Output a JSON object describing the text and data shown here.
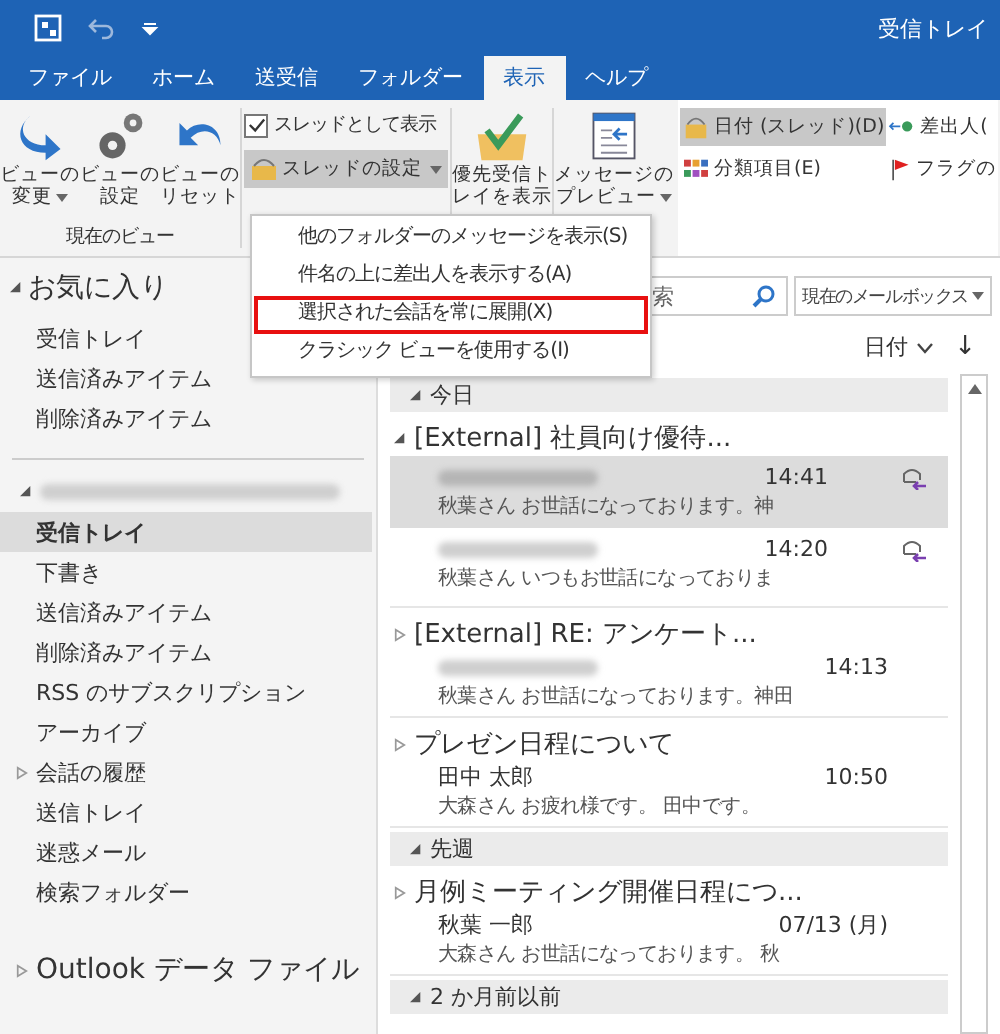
{
  "title_bar": {
    "title": "受信トレイ"
  },
  "ribbon_tabs": [
    {
      "label": "ファイル",
      "selected": false
    },
    {
      "label": "ホーム",
      "selected": false
    },
    {
      "label": "送受信",
      "selected": false
    },
    {
      "label": "フォルダー",
      "selected": false
    },
    {
      "label": "表示",
      "selected": true
    },
    {
      "label": "ヘルプ",
      "selected": false
    }
  ],
  "ribbon": {
    "view_buttons": [
      {
        "line1": "ビューの",
        "line2": "変更",
        "caret": true,
        "kind": "change"
      },
      {
        "line1": "ビューの",
        "line2": "設定",
        "caret": false,
        "kind": "settings"
      },
      {
        "line1": "ビューの",
        "line2": "リセット",
        "caret": false,
        "kind": "reset"
      }
    ],
    "view_group_label": "現在のビュー",
    "thread_checkbox": {
      "label": "スレッドとして表示",
      "checked": true
    },
    "thread_settings": {
      "label": "スレッドの設定",
      "selected": true
    },
    "focused_inbox": {
      "line1": "優先受信ト",
      "line2": "レイを表示"
    },
    "preview": {
      "line1": "メッセージの",
      "line2": "プレビュー"
    },
    "arrange": [
      {
        "label": "日付 (スレッド)(D)",
        "selected": true,
        "kind": "date"
      },
      {
        "label": "差出人(",
        "selected": false,
        "kind": "from"
      },
      {
        "label": "分類項目(E)",
        "selected": false,
        "kind": "category"
      },
      {
        "label": "フラグの",
        "selected": false,
        "kind": "flag"
      }
    ]
  },
  "dropdown_menu": {
    "items": [
      {
        "label": "他のフォルダーのメッセージを表示(S)",
        "outlined": false
      },
      {
        "label": "件名の上に差出人を表示する(A)",
        "outlined": false
      },
      {
        "label": "選択された会話を常に展開(X)",
        "outlined": true
      },
      {
        "label": "クラシック ビューを使用する(I)",
        "outlined": false
      }
    ]
  },
  "folder_pane": {
    "favorites": {
      "label": "お気に入り",
      "expanded": true,
      "items": [
        {
          "label": "受信トレイ",
          "selected": false
        },
        {
          "label": "送信済みアイテム",
          "selected": false
        },
        {
          "label": "削除済みアイテム",
          "selected": false
        }
      ]
    },
    "account": {
      "expanded": true,
      "items": [
        {
          "label": "受信トレイ",
          "selected": true
        },
        {
          "label": "下書き",
          "selected": false
        },
        {
          "label": "送信済みアイテム",
          "selected": false
        },
        {
          "label": "削除済みアイテム",
          "selected": false
        },
        {
          "label": "RSS のサブスクリプション",
          "selected": false
        },
        {
          "label": "アーカイブ",
          "selected": false
        },
        {
          "label": "会話の履歴",
          "selected": false,
          "expanded": false
        },
        {
          "label": "送信トレイ",
          "selected": false
        },
        {
          "label": "迷惑メール",
          "selected": false
        },
        {
          "label": "検索フォルダー",
          "selected": false
        }
      ]
    },
    "data_file": {
      "label": "Outlook データ ファイル",
      "expanded": false
    }
  },
  "mail_list": {
    "search": {
      "placeholder": "索"
    },
    "scope": "現在のメールボックス",
    "sort": {
      "label": "日付",
      "arrow": "↓"
    },
    "groups": [
      {
        "label": "今日",
        "expanded": true,
        "threads": [
          {
            "subject": "[External]  社員向け優待...",
            "expanded": true,
            "messages": [
              {
                "time": "14:41",
                "preview": "秋葉さん  お世話になっております。神",
                "selected": true
              },
              {
                "time": "14:20",
                "preview": "秋葉さん  いつもお世話になっておりま",
                "selected": false
              }
            ]
          },
          {
            "subject": "[External]  RE: アンケート...",
            "expanded": false,
            "time": "14:13",
            "preview": "秋葉さん  お世話になっております。神田"
          },
          {
            "subject": "プレゼン日程について",
            "expanded": false,
            "sender": "田中 太郎",
            "time": "10:50",
            "preview": "大森さん  お疲れ様です。 田中です。"
          }
        ]
      },
      {
        "label": "先週",
        "expanded": true,
        "threads": [
          {
            "subject": "月例ミーティング開催日程につ...",
            "expanded": false,
            "sender": "秋葉 一郎",
            "time": "07/13 (月)",
            "preview": "大森さん  お世話になっております。 秋"
          }
        ]
      },
      {
        "label": "2 か月前以前",
        "expanded": true
      }
    ]
  }
}
